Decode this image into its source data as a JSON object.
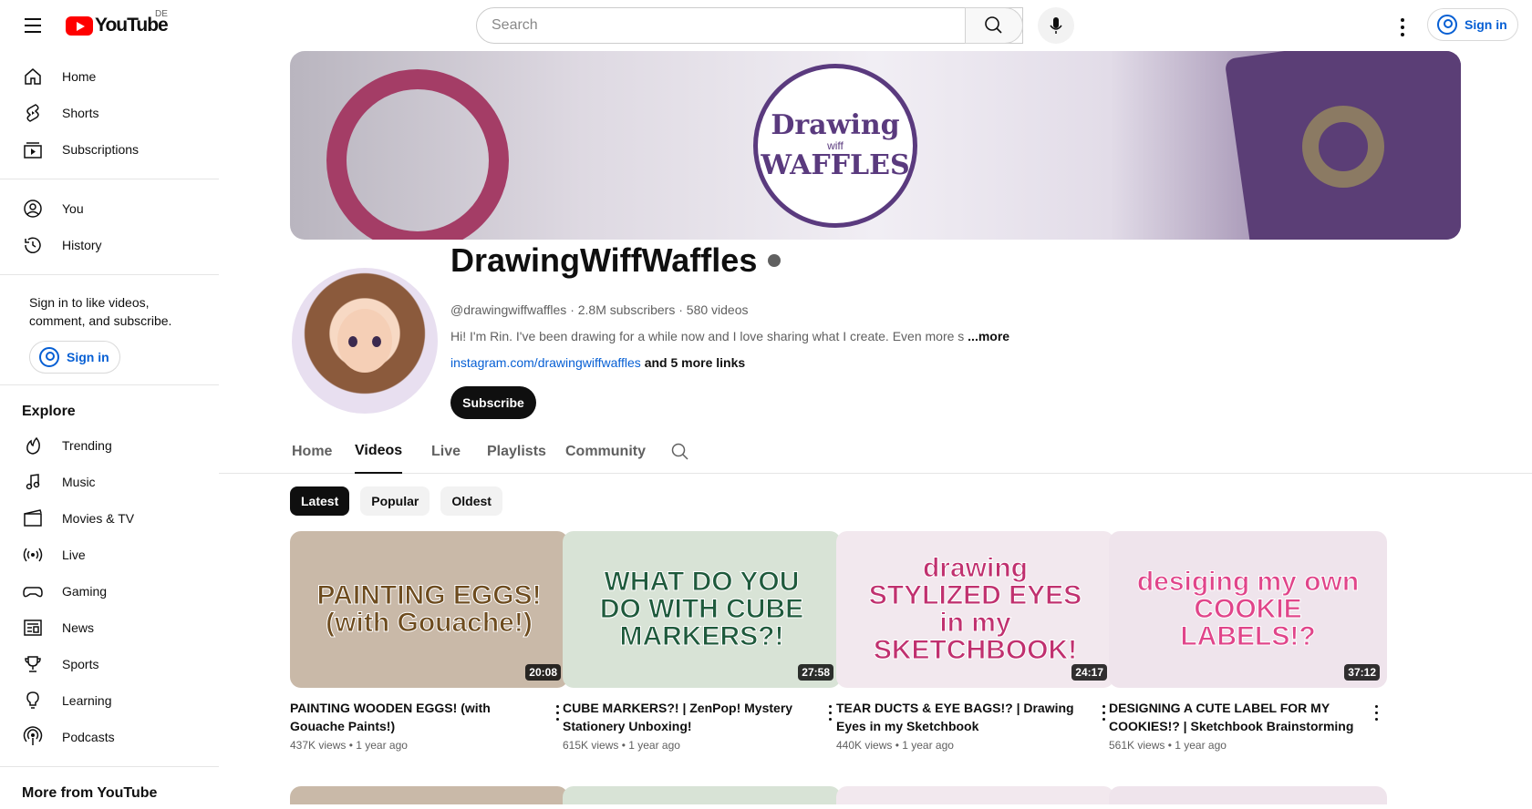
{
  "masthead": {
    "logo_text": "YouTube",
    "country_code": "DE",
    "search_placeholder": "Search",
    "signin_label": "Sign in"
  },
  "sidebar": {
    "primary": [
      {
        "label": "Home",
        "icon": "home-icon"
      },
      {
        "label": "Shorts",
        "icon": "shorts-icon"
      },
      {
        "label": "Subscriptions",
        "icon": "subscriptions-icon"
      }
    ],
    "secondary": [
      {
        "label": "You",
        "icon": "you-icon"
      },
      {
        "label": "History",
        "icon": "history-icon"
      }
    ],
    "signin_hint": "Sign in to like videos, comment, and subscribe.",
    "signin_label": "Sign in",
    "explore_title": "Explore",
    "explore": [
      {
        "label": "Trending",
        "icon": "trending-icon"
      },
      {
        "label": "Music",
        "icon": "music-icon"
      },
      {
        "label": "Movies & TV",
        "icon": "movies-icon"
      },
      {
        "label": "Live",
        "icon": "live-icon"
      },
      {
        "label": "Gaming",
        "icon": "gaming-icon"
      },
      {
        "label": "News",
        "icon": "news-icon"
      },
      {
        "label": "Sports",
        "icon": "sports-icon"
      },
      {
        "label": "Learning",
        "icon": "learning-icon"
      },
      {
        "label": "Podcasts",
        "icon": "podcasts-icon"
      }
    ],
    "more_title": "More from YouTube"
  },
  "channel": {
    "banner_text_1": "Drawing",
    "banner_text_2": "wiff",
    "banner_text_3": "WAFFLES",
    "name": "DrawingWiffWaffles",
    "meta": "@drawingwiffwaffles · 2.8M subscribers · 580 videos",
    "description": "Hi! I'm Rin. I've been drawing for a while now and I love sharing what I create. Even more s",
    "more": "...more",
    "link": "instagram.com/drawingwiffwaffles",
    "more_links": "and 5 more links",
    "subscribe_label": "Subscribe"
  },
  "tabs": [
    "Home",
    "Videos",
    "Live",
    "Playlists",
    "Community"
  ],
  "active_tab": "Videos",
  "chips": [
    "Latest",
    "Popular",
    "Oldest"
  ],
  "videos": [
    {
      "title": "PAINTING WOODEN EGGS! (with Gouache Paints!)",
      "thumb_text": "PAINTING EGGS! (with Gouache!)",
      "duration": "20:08",
      "views": "437K views",
      "age": "1 year ago",
      "color": "#c9b9a8"
    },
    {
      "title": "CUBE MARKERS?! | ZenPop! Mystery Stationery Unboxing!",
      "thumb_text": "WHAT DO YOU DO WITH CUBE MARKERS?!",
      "duration": "27:58",
      "views": "615K views",
      "age": "1 year ago",
      "color": "#d8e3d6"
    },
    {
      "title": "TEAR DUCTS & EYE BAGS!? | Drawing Eyes in my Sketchbook",
      "thumb_text": "drawing STYLIZED EYES in my SKETCHBOOK!",
      "duration": "24:17",
      "views": "440K views",
      "age": "1 year ago",
      "color": "#f2e8ee"
    },
    {
      "title": "DESIGNING A CUTE LABEL FOR MY COOKIES!? | Sketchbook Brainstorming &…",
      "thumb_text": "desiging my own COOKIE LABELS!?",
      "duration": "37:12",
      "views": "561K views",
      "age": "1 year ago",
      "color": "#efe4ec"
    }
  ]
}
